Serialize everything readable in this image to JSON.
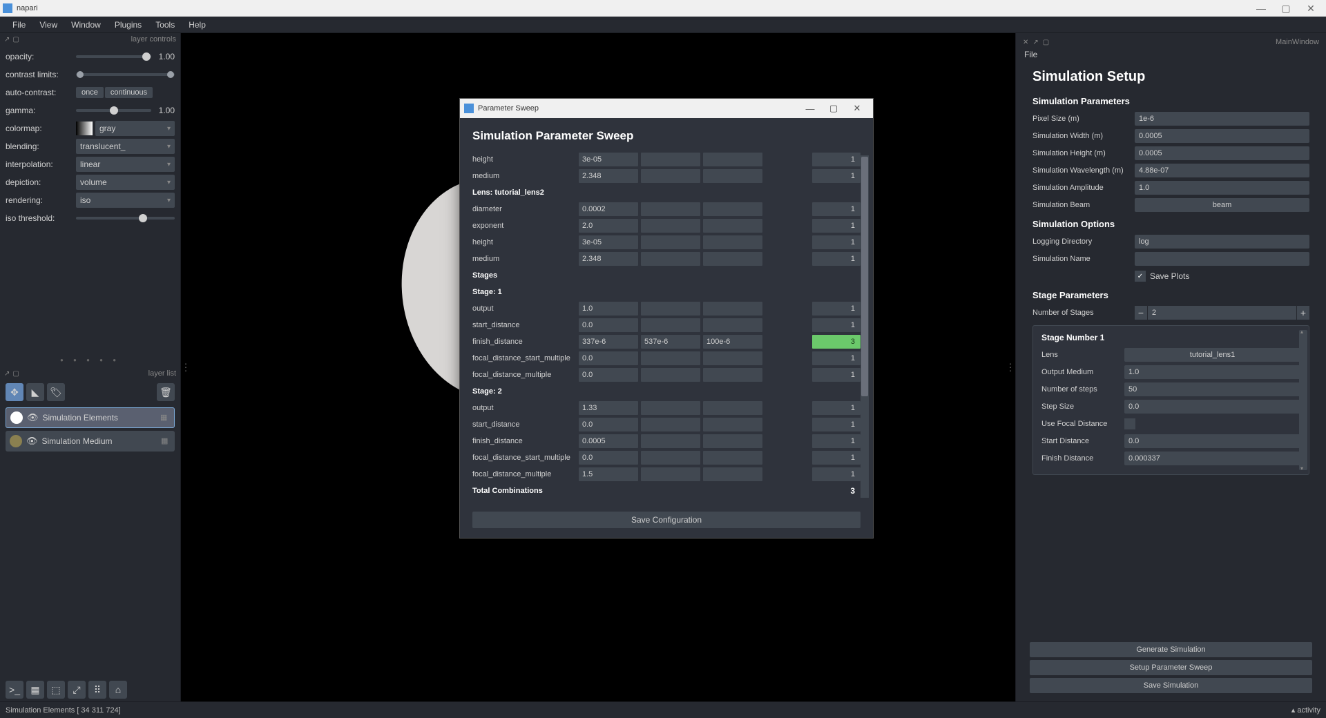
{
  "window": {
    "title": "napari"
  },
  "menu": {
    "file": "File",
    "view": "View",
    "window": "Window",
    "plugins": "Plugins",
    "tools": "Tools",
    "help": "Help"
  },
  "layer_controls": {
    "title": "layer controls",
    "opacity_lbl": "opacity:",
    "opacity_val": "1.00",
    "contrast_lbl": "contrast limits:",
    "auto_contrast_lbl": "auto-contrast:",
    "once": "once",
    "continuous": "continuous",
    "gamma_lbl": "gamma:",
    "gamma_val": "1.00",
    "colormap_lbl": "colormap:",
    "colormap_val": "gray",
    "blending_lbl": "blending:",
    "blending_val": "translucent_",
    "interpolation_lbl": "interpolation:",
    "interpolation_val": "linear",
    "depiction_lbl": "depiction:",
    "depiction_val": "volume",
    "rendering_lbl": "rendering:",
    "rendering_val": "iso",
    "iso_lbl": "iso threshold:"
  },
  "layer_list": {
    "title": "layer list",
    "items": [
      {
        "name": "Simulation Elements",
        "active": true
      },
      {
        "name": "Simulation Medium",
        "active": false
      }
    ]
  },
  "right": {
    "title": "MainWindow",
    "menu_file": "File",
    "heading": "Simulation Setup",
    "sim_params_h": "Simulation Parameters",
    "pixel_size_lbl": "Pixel Size (m)",
    "pixel_size_val": "1e-6",
    "sim_width_lbl": "Simulation Width (m)",
    "sim_width_val": "0.0005",
    "sim_height_lbl": "Simulation Height (m)",
    "sim_height_val": "0.0005",
    "sim_wave_lbl": "Simulation Wavelength (m)",
    "sim_wave_val": "4.88e-07",
    "sim_amp_lbl": "Simulation Amplitude",
    "sim_amp_val": "1.0",
    "sim_beam_lbl": "Simulation Beam",
    "sim_beam_val": "beam",
    "sim_opts_h": "Simulation Options",
    "log_dir_lbl": "Logging Directory",
    "log_dir_val": "log",
    "sim_name_lbl": "Simulation Name",
    "sim_name_val": "",
    "save_plots_lbl": "Save Plots",
    "stage_params_h": "Stage Parameters",
    "num_stages_lbl": "Number of Stages",
    "num_stages_val": "2",
    "stage1_h": "Stage Number 1",
    "lens_lbl": "Lens",
    "lens_val": "tutorial_lens1",
    "medium_lbl": "Output Medium",
    "medium_val": "1.0",
    "nsteps_lbl": "Number of steps",
    "nsteps_val": "50",
    "step_lbl": "Step Size",
    "step_val": "0.0",
    "focal_lbl": "Use Focal Distance",
    "start_lbl": "Start Distance",
    "start_val": "0.0",
    "finish_lbl": "Finish Distance",
    "finish_val": "0.000337",
    "btn_gen": "Generate Simulation",
    "btn_sweep": "Setup Parameter Sweep",
    "btn_save": "Save Simulation"
  },
  "dialog": {
    "title": "Parameter Sweep",
    "heading": "Simulation Parameter Sweep",
    "rows": [
      {
        "label": "height",
        "v1": "3e-05",
        "v2": "",
        "v3": "",
        "count": "1"
      },
      {
        "label": "medium",
        "v1": "2.348",
        "v2": "",
        "v3": "",
        "count": "1"
      },
      {
        "label": "Lens: tutorial_lens2",
        "header": true
      },
      {
        "label": "diameter",
        "v1": "0.0002",
        "v2": "",
        "v3": "",
        "count": "1"
      },
      {
        "label": "exponent",
        "v1": "2.0",
        "v2": "",
        "v3": "",
        "count": "1"
      },
      {
        "label": "height",
        "v1": "3e-05",
        "v2": "",
        "v3": "",
        "count": "1"
      },
      {
        "label": "medium",
        "v1": "2.348",
        "v2": "",
        "v3": "",
        "count": "1"
      },
      {
        "label": "Stages",
        "header": true,
        "bold": true
      },
      {
        "label": "Stage: 1",
        "header": true
      },
      {
        "label": "output",
        "v1": "1.0",
        "v2": "",
        "v3": "",
        "count": "1"
      },
      {
        "label": "start_distance",
        "v1": "0.0",
        "v2": "",
        "v3": "",
        "count": "1"
      },
      {
        "label": "finish_distance",
        "v1": "337e-6",
        "v2": "537e-6",
        "v3": "100e-6",
        "count": "3",
        "green": true
      },
      {
        "label": "focal_distance_start_multiple",
        "v1": "0.0",
        "v2": "",
        "v3": "",
        "count": "1"
      },
      {
        "label": "focal_distance_multiple",
        "v1": "0.0",
        "v2": "",
        "v3": "",
        "count": "1"
      },
      {
        "label": "Stage: 2",
        "header": true
      },
      {
        "label": "output",
        "v1": "1.33",
        "v2": "",
        "v3": "",
        "count": "1"
      },
      {
        "label": "start_distance",
        "v1": "0.0",
        "v2": "",
        "v3": "",
        "count": "1"
      },
      {
        "label": "finish_distance",
        "v1": "0.0005",
        "v2": "",
        "v3": "",
        "count": "1"
      },
      {
        "label": "focal_distance_start_multiple",
        "v1": "0.0",
        "v2": "",
        "v3": "",
        "count": "1"
      },
      {
        "label": "focal_distance_multiple",
        "v1": "1.5",
        "v2": "",
        "v3": "",
        "count": "1"
      }
    ],
    "total_lbl": "Total Combinations",
    "total_val": "3",
    "save_btn": "Save Configuration"
  },
  "status": {
    "text": "Simulation Elements [ 34 311 724]",
    "activity": "activity"
  }
}
